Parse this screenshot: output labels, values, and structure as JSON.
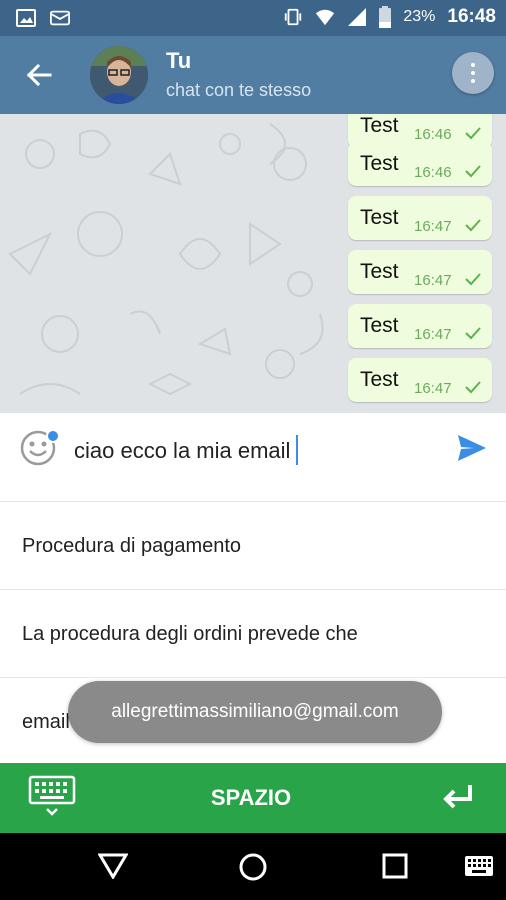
{
  "status_bar": {
    "battery_percent": "23%",
    "time": "16:48",
    "icons": [
      "image-icon",
      "mail-icon",
      "vibrate-icon",
      "wifi-icon",
      "signal-icon",
      "battery-icon"
    ]
  },
  "header": {
    "title": "Tu",
    "subtitle": "chat con te stesso",
    "icons": [
      "back-arrow-icon",
      "avatar",
      "more-vert-icon"
    ]
  },
  "chat": {
    "messages": [
      {
        "text": "Test",
        "time": "16:46"
      },
      {
        "text": "Test",
        "time": "16:46"
      },
      {
        "text": "Test",
        "time": "16:47"
      },
      {
        "text": "Test",
        "time": "16:47"
      },
      {
        "text": "Test",
        "time": "16:47"
      },
      {
        "text": "Test",
        "time": "16:47"
      }
    ]
  },
  "input": {
    "value": "ciao ecco la mia email"
  },
  "suggestions": [
    {
      "text": "Procedura di pagamento"
    },
    {
      "text": "La procedura degli ordini prevede che"
    },
    {
      "text": "email"
    }
  ],
  "toast": {
    "text": "allegrettimassimiliano@gmail.com"
  },
  "keyboard_bar": {
    "space_label": "SPAZIO"
  },
  "colors": {
    "status_bar": "#3d6589",
    "header": "#527da3",
    "chat_background": "#dfe3e6",
    "bubble": "#effdde",
    "keyboard_bar": "#2aa448",
    "send_accent": "#3a8ee6"
  }
}
